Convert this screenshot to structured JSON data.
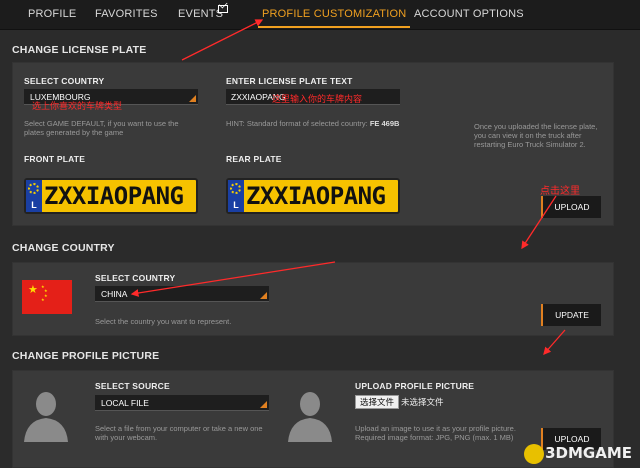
{
  "nav": {
    "tabs": [
      {
        "label": "PROFILE"
      },
      {
        "label": "FAVORITES"
      },
      {
        "label": "EVENTS"
      },
      {
        "label": "PROFILE CUSTOMIZATION"
      },
      {
        "label": "ACCOUNT OPTIONS"
      }
    ],
    "active_index": 3
  },
  "license": {
    "title": "CHANGE LICENSE PLATE",
    "select_label": "SELECT COUNTRY",
    "select_value": "LUXEMBOURG",
    "select_hint": "Select GAME DEFAULT, if you want to use the plates generated by the game",
    "text_label": "ENTER LICENSE PLATE TEXT",
    "text_value": "ZXXIAOPANG",
    "hint_prefix": "HINT: Standard format of selected country:",
    "hint_format": "FE 469B",
    "upload_note": "Once you uploaded the license plate, you can view it on the truck after restarting Euro Truck Simulator 2.",
    "front_label": "FRONT PLATE",
    "rear_label": "REAR PLATE",
    "plate_text": "ZXXIAOPANG",
    "plate_country_letter": "L",
    "upload_button": "UPLOAD"
  },
  "country": {
    "title": "CHANGE COUNTRY",
    "select_label": "SELECT COUNTRY",
    "select_value": "CHINA",
    "hint": "Select the country you want to represent.",
    "update_button": "UPDATE"
  },
  "picture": {
    "title": "CHANGE PROFILE PICTURE",
    "source_label": "SELECT SOURCE",
    "source_value": "LOCAL FILE",
    "source_hint": "Select a file from your computer or take a new one with your webcam.",
    "upload_label": "UPLOAD PROFILE PICTURE",
    "file_button": "选择文件",
    "file_none": "未选择文件",
    "upload_hint_1": "Upload an image to use it as your profile picture.",
    "upload_hint_2": "Required image format: JPG, PNG (max. 1 MB)",
    "upload_button": "UPLOAD"
  },
  "annotations": {
    "select_plate_type": "选上你喜欢的车牌类型",
    "enter_plate_text": "这里输入你的车牌内容",
    "click_here": "点击这里"
  },
  "watermark": "3DMGAME",
  "colors": {
    "accent": "#f0a020",
    "annotation": "#ff2a2a",
    "plate": "#f6c200",
    "eu_blue": "#1a3fa3"
  }
}
